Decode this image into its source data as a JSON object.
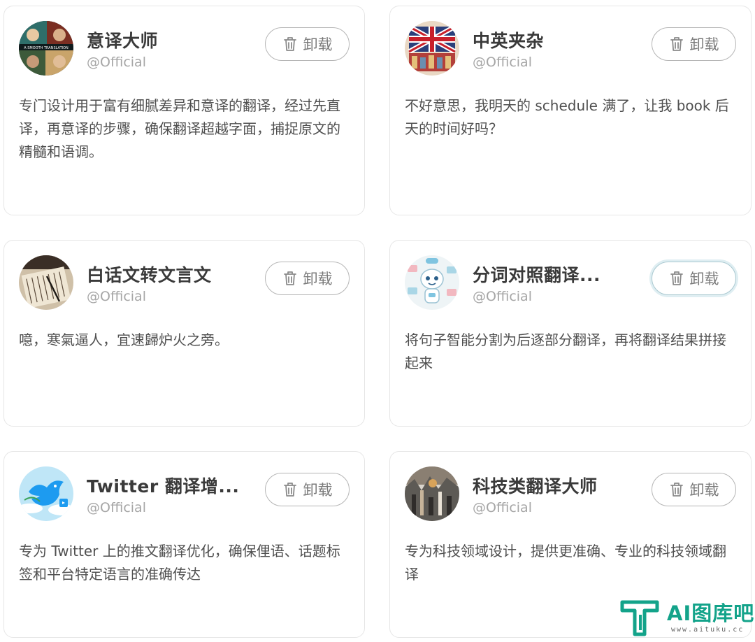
{
  "uninstall_label": "卸载",
  "cards": [
    {
      "title": "意译大师",
      "author": "@Official",
      "description": "专门设计用于富有细腻差异和意译的翻译，经过先直译，再意译的步骤，确保翻译超越字面，捕捉原文的精髓和语调。",
      "avatar_caption": "A SMOOTH TRANSLATION"
    },
    {
      "title": "中英夹杂",
      "author": "@Official",
      "description": "不好意思，我明天的 schedule 满了，让我 book 后天的时间好吗？"
    },
    {
      "title": "白话文转文言文",
      "author": "@Official",
      "description": "噫，寒氣逼人，宜速歸炉火之旁。"
    },
    {
      "title": "分词对照翻译...",
      "author": "@Official",
      "description": "将句子智能分割为后逐部分翻译，再将翻译结果拼接起来"
    },
    {
      "title": "Twitter 翻译增...",
      "author": "@Official",
      "description": "专为 Twitter 上的推文翻译优化，确保俚语、话题标签和平台特定语言的准确传达"
    },
    {
      "title": "科技类翻译大师",
      "author": "@Official",
      "description": "专为科技领域设计，提供更准确、专业的科技领域翻译"
    }
  ],
  "watermark": {
    "text": "AI图库吧",
    "url": "www.aituku.cc",
    "color": "#13a38a"
  },
  "icons": [
    "trash-icon"
  ]
}
